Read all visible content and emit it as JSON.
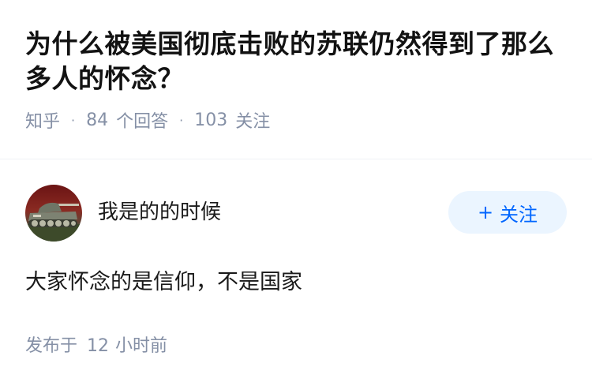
{
  "question": {
    "title": "为什么被美国彻底击败的苏联仍然得到了那么多人的怀念？",
    "source": "知乎",
    "answer_count": "84",
    "answer_label": "个回答",
    "follow_count": "103",
    "follow_label": "关注"
  },
  "answer": {
    "author_name": "我是的的时候",
    "follow_button_plus": "+",
    "follow_button_label": "关注",
    "content": "大家怀念的是信仰，不是国家",
    "posted_prefix": "发布于",
    "posted_value": "12",
    "posted_unit": "小时前"
  },
  "colors": {
    "accent": "#0066ff",
    "follow_bg": "#ebf5ff",
    "meta_text": "#8590a6"
  },
  "icons": {
    "avatar": "tank-avatar"
  }
}
